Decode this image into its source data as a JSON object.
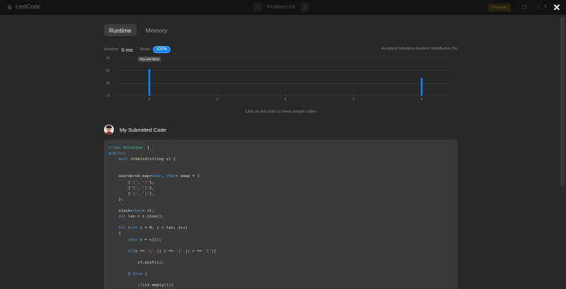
{
  "topbar": {
    "brand": "LeetCode",
    "center_label": "Problem List",
    "premium_label": "Premium",
    "counter": "0"
  },
  "tabs": [
    {
      "label": "Runtime",
      "active": true
    },
    {
      "label": "Memory",
      "active": false
    }
  ],
  "stats": {
    "runtime_label": "Runtime",
    "runtime_value": "0 ms",
    "beats_label": "Beats",
    "beats_value": "100%",
    "distribution_label": "Accepted Solutions Runtime Distribution (%)"
  },
  "chart_data": {
    "type": "bar",
    "title": "",
    "xlabel": "",
    "ylabel": "",
    "x_ticks": [
      "0",
      "1",
      "2",
      "3",
      "4"
    ],
    "y_ticks": [
      "0",
      "25",
      "50",
      "75"
    ],
    "ylim": [
      0,
      75
    ],
    "xlim": [
      -0.5,
      4.5
    ],
    "grid": true,
    "bar_color": "#0a84ff",
    "bars": [
      {
        "x": 0,
        "value": 53
      },
      {
        "x": 1,
        "value": 1
      },
      {
        "x": 2,
        "value": 2
      },
      {
        "x": 3,
        "value": 1
      },
      {
        "x": 4,
        "value": 35
      }
    ],
    "tooltip": {
      "x": 0,
      "text": "You are here!"
    }
  },
  "hint": "Click on the chart to check sample codes",
  "submitted": {
    "title": "My Submitted Code"
  },
  "code_lines": [
    [
      [
        "kw",
        "class "
      ],
      [
        "ty",
        "Solution"
      ],
      [
        "",
        "  {"
      ]
    ],
    [
      [
        "kw",
        "public"
      ],
      [
        "",
        ":"
      ]
    ],
    [
      [
        "",
        "    "
      ],
      [
        "kw",
        "bool "
      ],
      [
        "fn",
        "isValid"
      ],
      [
        "",
        "(string s) {"
      ]
    ],
    [
      [
        "",
        ""
      ]
    ],
    [
      [
        "",
        ""
      ]
    ],
    [
      [
        "",
        "    unordered_map<"
      ],
      [
        "kw",
        "char"
      ],
      [
        "",
        ", "
      ],
      [
        "kw",
        "char"
      ],
      [
        "",
        "> umap = {"
      ]
    ],
    [
      [
        "",
        "        {"
      ],
      [
        "str",
        "'('"
      ],
      [
        "",
        ", "
      ],
      [
        "str",
        "')'"
      ],
      [
        "",
        "},"
      ]
    ],
    [
      [
        "",
        "        {"
      ],
      [
        "str",
        "'['"
      ],
      [
        "",
        ", "
      ],
      [
        "str",
        "']'"
      ],
      [
        "",
        "},"
      ]
    ],
    [
      [
        "",
        "        {"
      ],
      [
        "str",
        "'{'"
      ],
      [
        "",
        ", "
      ],
      [
        "str",
        "'}'"
      ],
      [
        "",
        "},"
      ]
    ],
    [
      [
        "",
        "    };"
      ]
    ],
    [
      [
        "",
        ""
      ]
    ],
    [
      [
        "",
        "    stack<"
      ],
      [
        "kw",
        "char"
      ],
      [
        "",
        "> st;"
      ]
    ],
    [
      [
        "",
        "    "
      ],
      [
        "kw",
        "int"
      ],
      [
        "",
        " len = s.size();"
      ]
    ],
    [
      [
        "",
        ""
      ]
    ],
    [
      [
        "",
        "    "
      ],
      [
        "kw",
        "for"
      ],
      [
        "",
        " ("
      ],
      [
        "kw",
        "int"
      ],
      [
        "",
        " i = 0; i < len; i++)"
      ]
    ],
    [
      [
        "",
        "    {"
      ]
    ],
    [
      [
        "",
        "        "
      ],
      [
        "kw",
        "char"
      ],
      [
        "",
        " c = s[i];"
      ]
    ],
    [
      [
        "",
        ""
      ]
    ],
    [
      [
        "",
        "        "
      ],
      [
        "kw",
        "if"
      ],
      [
        "",
        "(c == "
      ],
      [
        "str",
        "'('"
      ],
      [
        "",
        " || c == "
      ],
      [
        "str",
        "'['"
      ],
      [
        "",
        " || c == "
      ],
      [
        "str",
        "'{'"
      ],
      [
        "",
        "){"
      ]
    ],
    [
      [
        "",
        ""
      ]
    ],
    [
      [
        "",
        "            st.push(c);"
      ]
    ],
    [
      [
        "",
        ""
      ]
    ],
    [
      [
        "",
        "        } "
      ],
      [
        "kw",
        "else"
      ],
      [
        "",
        " {"
      ]
    ],
    [
      [
        "",
        ""
      ]
    ],
    [
      [
        "",
        "            "
      ],
      [
        "kw",
        "if"
      ],
      [
        "",
        "(st.empty()){"
      ]
    ]
  ]
}
